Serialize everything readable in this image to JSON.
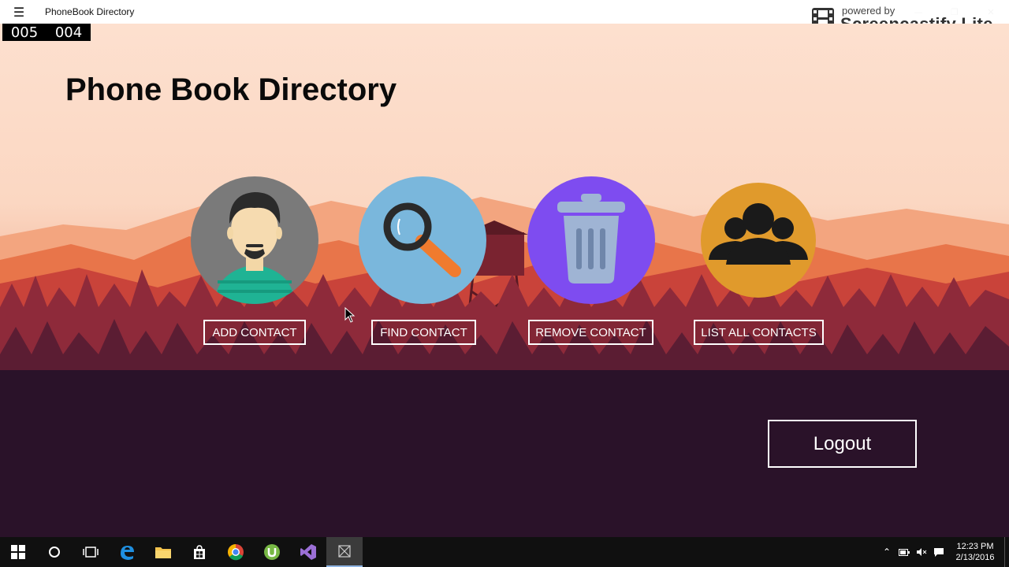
{
  "window": {
    "menu_icon": "hamburger-icon",
    "title": "PhoneBook Directory",
    "controls": [
      "—",
      "❐",
      "✕"
    ]
  },
  "watermark": {
    "line1": "powered by",
    "line2": "Screencastify Lite"
  },
  "counter": {
    "left": "005",
    "right": "004"
  },
  "page": {
    "title": "Phone Book Directory"
  },
  "actions": [
    {
      "label": "ADD CONTACT",
      "icon": "person-avatar-icon",
      "color": "#7a7a7a"
    },
    {
      "label": "FIND CONTACT",
      "icon": "magnifier-icon",
      "color": "#7ab7dc"
    },
    {
      "label": "REMOVE CONTACT",
      "icon": "trash-can-icon",
      "color": "#7e4cf0"
    },
    {
      "label": "LIST ALL CONTACTS",
      "icon": "group-icon",
      "color": "#e09a2c"
    }
  ],
  "logout": {
    "label": "Logout"
  },
  "taskbar": {
    "apps": [
      "windows-start-icon",
      "cortana-icon",
      "task-view-icon",
      "edge-icon",
      "file-explorer-icon",
      "store-icon",
      "chrome-icon",
      "utorrent-icon",
      "visual-studio-icon",
      "app-window-icon"
    ],
    "time": "12:23 PM",
    "date": "2/13/2016"
  }
}
